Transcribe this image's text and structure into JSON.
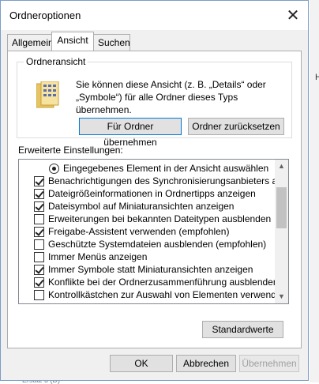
{
  "window": {
    "title": "Ordneroptionen"
  },
  "tabs": [
    {
      "label": "Allgemein",
      "active": false
    },
    {
      "label": "Ansicht",
      "active": true
    },
    {
      "label": "Suchen",
      "active": false
    }
  ],
  "folder_view": {
    "label": "Ordneransicht",
    "description": "Sie können diese Ansicht (z. B. „Details“ oder „Symbole“) für alle Ordner dieses Typs übernehmen.",
    "apply_button": "Für Ordner übernehmen",
    "reset_button": "Ordner zurücksetzen"
  },
  "advanced": {
    "label": "Erweiterte Einstellungen:",
    "items": [
      {
        "type": "radio",
        "checked": true,
        "label": "Eingegebenes Element in der Ansicht auswählen",
        "indent": 1
      },
      {
        "type": "checkbox",
        "checked": true,
        "label": "Benachrichtigungen des Synchronisierungsanbieters anzeigen",
        "indent": 0
      },
      {
        "type": "checkbox",
        "checked": true,
        "label": "Dateigrößeinformationen in Ordnertipps anzeigen",
        "indent": 0
      },
      {
        "type": "checkbox",
        "checked": true,
        "label": "Dateisymbol auf Miniaturansichten anzeigen",
        "indent": 0
      },
      {
        "type": "checkbox",
        "checked": false,
        "label": "Erweiterungen bei bekannten Dateitypen ausblenden",
        "indent": 0
      },
      {
        "type": "checkbox",
        "checked": true,
        "label": "Freigabe-Assistent verwenden (empfohlen)",
        "indent": 0
      },
      {
        "type": "checkbox",
        "checked": false,
        "label": "Geschützte Systemdateien ausblenden (empfohlen)",
        "indent": 0
      },
      {
        "type": "checkbox",
        "checked": false,
        "label": "Immer Menüs anzeigen",
        "indent": 0
      },
      {
        "type": "checkbox",
        "checked": true,
        "label": "Immer Symbole statt Miniaturansichten anzeigen",
        "indent": 0
      },
      {
        "type": "checkbox",
        "checked": true,
        "label": "Konflikte bei der Ordnerzusammenführung ausblenden",
        "indent": 0
      },
      {
        "type": "checkbox",
        "checked": false,
        "label": "Kontrollkästchen zur Auswahl von Elementen verwenden",
        "indent": 0
      }
    ],
    "defaults_button": "Standardwerte"
  },
  "footer": {
    "ok": "OK",
    "cancel": "Abbrechen",
    "apply": "Übernehmen"
  },
  "background": {
    "right_text": "H",
    "bottom_text": "Ersatz 3 (D)"
  },
  "colors": {
    "highlight": "#f0f000",
    "focus_border": "#0078d7",
    "dialog_bg": "#f0f0f0"
  }
}
